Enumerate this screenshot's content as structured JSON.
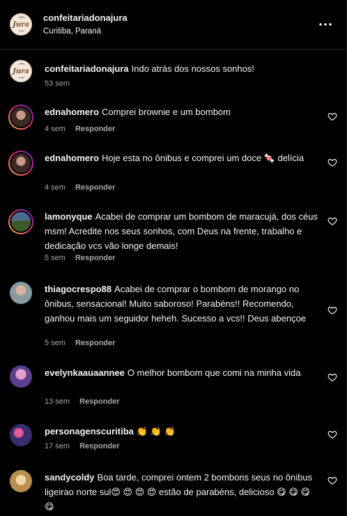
{
  "header": {
    "account": "confeitariadonajura",
    "location": "Curitiba, Paraná",
    "logo_text": "Jura"
  },
  "caption": {
    "user": "confeitariadonajura",
    "text": "Indo atrás dos nossos sonhos!",
    "time": "53 sem"
  },
  "reply_label": "Responder",
  "comments": [
    {
      "user": "ednahomero",
      "text": "Comprei brownie e um bombom",
      "time": "4 sem"
    },
    {
      "user": "ednahomero",
      "text": "Hoje esta no ônibus e comprei um doce 🍬 delícia",
      "time": "4 sem"
    },
    {
      "user": "lamonyque",
      "text": "Acabei de comprar um bombom de maracujá, dos céus msm! Acredite nos seus sonhos, com Deus na frente, trabalho e dedicação vcs vão longe demais!",
      "time": "5 sem"
    },
    {
      "user": "thiagocrespo88",
      "text": "Acabei de comprar o bombom de morango no ônibus, sensacional! Muito saboroso! Parabéns!! Recomendo, ganhou mais um seguidor heheh. Sucesso a vcs!! Deus abençoe",
      "time": "5 sem"
    },
    {
      "user": "evelynkaauaannee",
      "text": "O melhor bombom que comi na minha vida",
      "time": "13 sem"
    },
    {
      "user": "personagenscuritiba",
      "text": "👏 👏 👏",
      "time": "17 sem"
    },
    {
      "user": "sandycoldy",
      "text": "Boa tarde, comprei ontem 2 bombons seus no ônibus ligeirao norte sul😍 😍 😍 😍 estão de parabéns, delicioso 😋 😋 😋 😋",
      "time": ""
    }
  ]
}
